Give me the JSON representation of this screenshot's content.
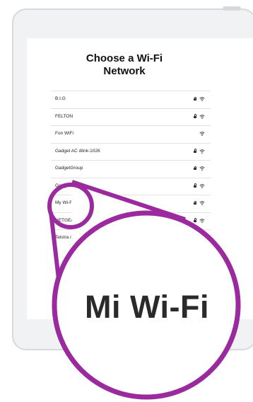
{
  "screen": {
    "title_line1": "Choose a Wi-Fi",
    "title_line2": "Network"
  },
  "networks": [
    {
      "name": "B.I.G",
      "locked": true
    },
    {
      "name": "FELTON",
      "locked": true
    },
    {
      "name": "Fon WiFi",
      "locked": false
    },
    {
      "name": "Gadget AC dlink-1026",
      "locked": true
    },
    {
      "name": "GadgetGroup",
      "locked": true
    },
    {
      "name": "Gadget",
      "locked": true
    },
    {
      "name": "My Wi-Fi Network",
      "locked": true
    },
    {
      "name": "NETGEAR4",
      "locked": true
    },
    {
      "name": "Telstra A",
      "locked": false
    }
  ],
  "magnifier": {
    "text": "Mi Wi-Fi",
    "color": "#9b2a9e"
  },
  "colors": {
    "tablet_frame": "#f1f2f3",
    "tablet_border": "#d7d9dc",
    "accent": "#9b2a9e"
  }
}
